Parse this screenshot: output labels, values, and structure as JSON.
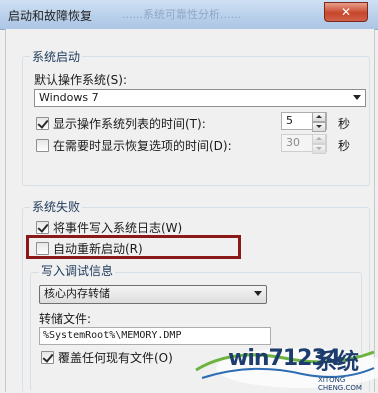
{
  "window": {
    "title": "启动和故障恢复",
    "blurred_title": "......系统可靠性分析......",
    "close_glyph": "✕"
  },
  "startup": {
    "group_label": "系统启动",
    "default_os_label": "默认操作系统(S):",
    "default_os_value": "Windows 7",
    "show_list": {
      "label": "显示操作系统列表的时间(T):",
      "checked": true,
      "value": "5",
      "unit": "秒"
    },
    "show_recovery": {
      "label": "在需要时显示恢复选项的时间(D):",
      "checked": false,
      "value": "30",
      "unit": "秒"
    }
  },
  "failure": {
    "group_label": "系统失败",
    "write_log": {
      "label": "将事件写入系统日志(W)",
      "checked": true
    },
    "auto_restart": {
      "label": "自动重新启动(R)",
      "checked": false
    },
    "debug": {
      "group_label": "写入调试信息",
      "type_value": "核心内存转储",
      "dump_file_label": "转储文件:",
      "dump_file_value": "%SystemRoot%\\MEMORY.DMP",
      "overwrite": {
        "label": "覆盖任何现有文件(O)",
        "checked": true
      }
    }
  },
  "watermark": {
    "text": "win71234",
    "cn": "系统",
    "url": "XITONG CHENG.COM"
  },
  "colors": {
    "highlight": "#8a1a1a",
    "group_label": "#1e395b"
  }
}
